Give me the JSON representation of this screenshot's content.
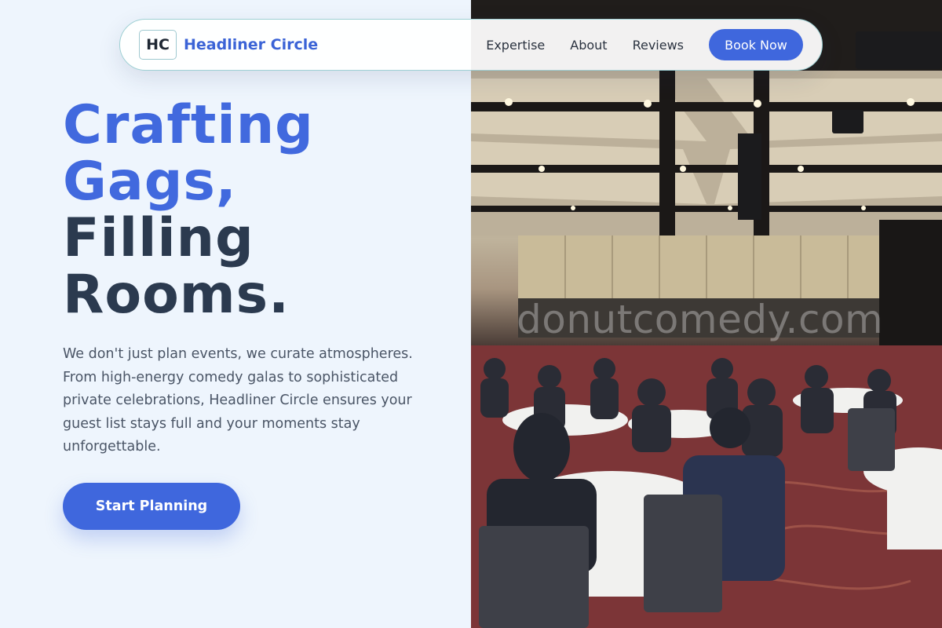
{
  "nav": {
    "logo_initials": "HC",
    "brand_name": "Headliner Circle",
    "links": [
      "Expertise",
      "About",
      "Reviews"
    ],
    "cta_label": "Book Now"
  },
  "hero": {
    "headline_accent": [
      "Crafting",
      "Gags,"
    ],
    "headline_dark": [
      "Filling",
      "Rooms."
    ],
    "lede": "We don't just plan events, we curate atmospheres. From high-energy comedy galas to sophisticated private celebrations, Headliner Circle ensures your guest list stays full and your moments stay unforgettable.",
    "cta_label": "Start Planning"
  },
  "photo": {
    "watermark": "donutcomedy.com"
  },
  "colors": {
    "accent": "#3f67dd",
    "headline_dark": "#2b3a4f",
    "background": "#eef5fd"
  }
}
